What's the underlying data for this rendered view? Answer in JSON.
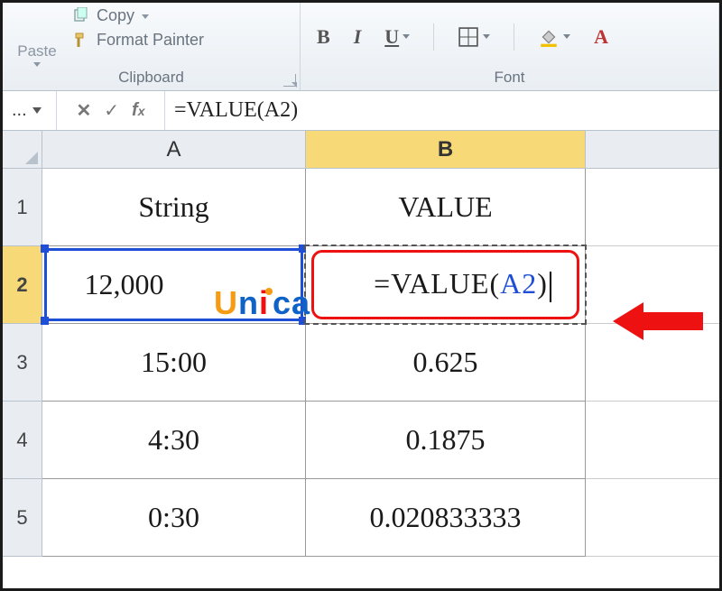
{
  "ribbon": {
    "clipboard": {
      "paste": "Paste",
      "copy": "Copy",
      "format_painter": "Format Painter",
      "group_label": "Clipboard"
    },
    "font": {
      "bold": "B",
      "italic": "I",
      "underline": "U",
      "group_label": "Font"
    }
  },
  "formula_bar": {
    "namebox": "...",
    "value": "=VALUE(A2)"
  },
  "columns": {
    "A": "A",
    "B": "B",
    "C": ""
  },
  "rows": [
    "1",
    "2",
    "3",
    "4",
    "5"
  ],
  "cells": {
    "A1": "String",
    "B1": "VALUE",
    "A2": "12,000",
    "B2_formula_eq": "=",
    "B2_formula_fn": "VALUE(",
    "B2_formula_ref": "A2",
    "B2_formula_close": ")",
    "A3": "15:00",
    "B3": "0.625",
    "A4": "4:30",
    "B4": "0.1875",
    "A5": "0:30",
    "B5": "0.020833333"
  },
  "watermark": {
    "u": "U",
    "n": "n",
    "i": "i",
    "c": "c",
    "a": "a"
  }
}
